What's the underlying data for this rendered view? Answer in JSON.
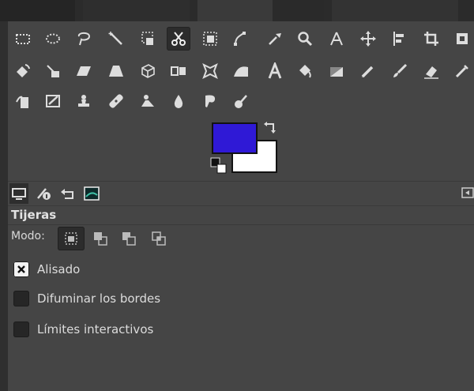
{
  "colors": {
    "foreground": "#2f19d6",
    "background": "#ffffff"
  },
  "toolbox": {
    "rows": [
      [
        "rect-select",
        "ellipse-select",
        "free-select",
        "fuzzy-select",
        "select-by-color",
        "scissors-select",
        "foreground-select",
        "paths",
        "color-picker",
        "zoom",
        "measure",
        "move",
        "align",
        "crop",
        "unified-transform"
      ],
      [
        "rotate",
        "scale",
        "shear",
        "perspective",
        "3d-transform",
        "flip",
        "cage",
        "warp",
        "text",
        "bucket-fill",
        "blend",
        "pencil",
        "paintbrush",
        "eraser",
        "airbrush"
      ],
      [
        "ink",
        "mypaint-brush",
        "clone",
        "heal",
        "perspective-clone",
        "blur",
        "smudge",
        "dodge-burn"
      ]
    ],
    "active": "scissors-select"
  },
  "panel_tabs": [
    "tool-options",
    "device-status",
    "undo-history",
    "images"
  ],
  "tool_options": {
    "title": "Tijeras",
    "mode_label": "Modo:",
    "modes": [
      "replace",
      "add",
      "subtract",
      "intersect"
    ],
    "active_mode": "replace",
    "options": [
      {
        "label": "Alisado",
        "checked": true
      },
      {
        "label": "Difuminar los bordes",
        "checked": false
      },
      {
        "label": "Límites interactivos",
        "checked": false
      }
    ]
  }
}
